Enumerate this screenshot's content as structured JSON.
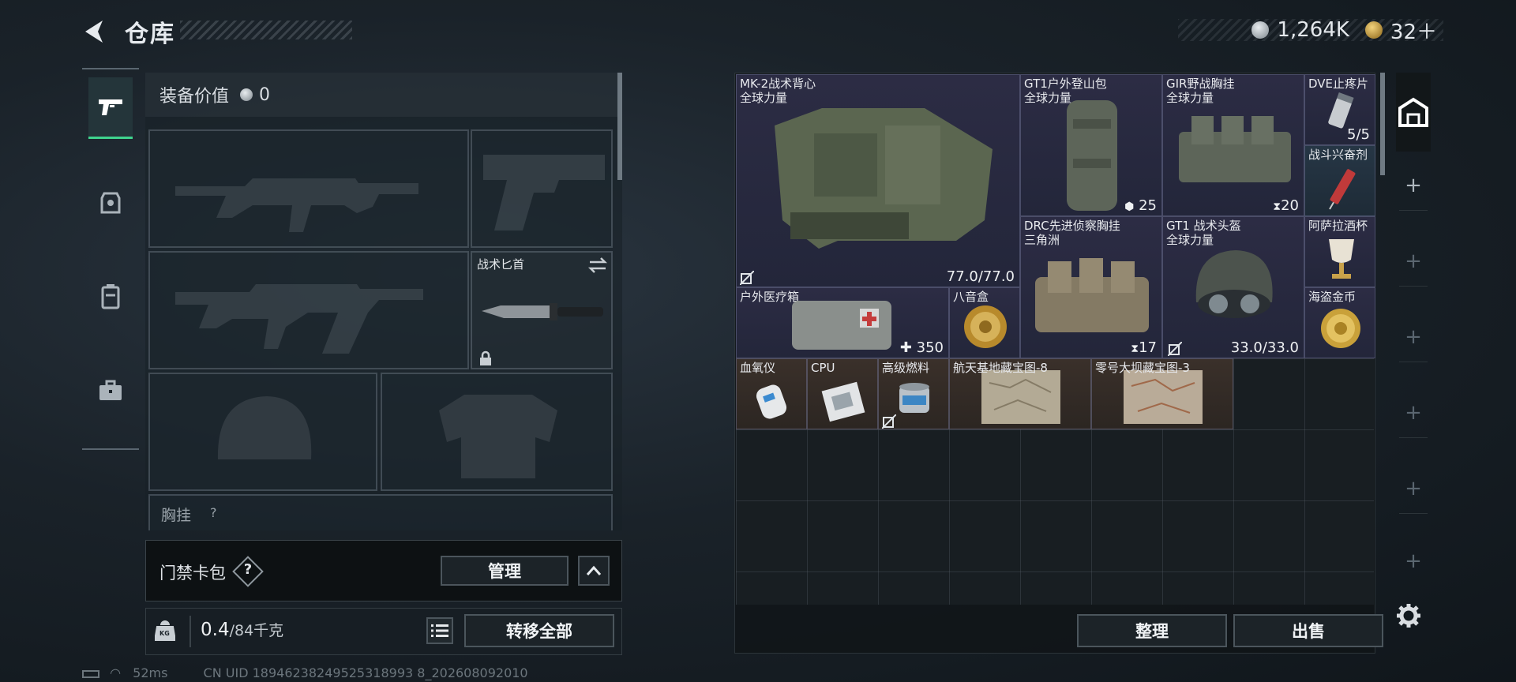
{
  "header": {
    "title": "仓库",
    "silver_amount": "1,264K",
    "gold_amount": "32＋"
  },
  "sidebar": {
    "items": [
      "weapons",
      "helmet",
      "backpack",
      "briefcase"
    ]
  },
  "equipment": {
    "value_label": "装备价值",
    "value": "0",
    "knife_label": "战术匕首",
    "next_slot_label": "胸挂",
    "next_slot_icon_label": "?"
  },
  "keybag": {
    "label": "门禁卡包",
    "help_glyph": "?",
    "manage_label": "管理"
  },
  "weight": {
    "current": "0.4",
    "capacity": "/84千克",
    "transfer_all_label": "转移全部",
    "kg_tag": "KG"
  },
  "inventory": {
    "items": [
      {
        "name": "MK-2战术背心",
        "sub": "全球力量",
        "stat": "77.0/77.0",
        "rarity": "purple"
      },
      {
        "name": "GT1户外登山包",
        "sub": "全球力量",
        "stat": "25",
        "rarity": "purple"
      },
      {
        "name": "GIR野战胸挂",
        "sub": "全球力量",
        "stat": "20",
        "rarity": "purple"
      },
      {
        "name": "DVE止疼片",
        "sub": "",
        "stat": "5/5",
        "rarity": "purple"
      },
      {
        "name": "战斗兴奋剂",
        "sub": "",
        "stat": "",
        "rarity": "blue"
      },
      {
        "name": "DRC先进侦察胸挂",
        "sub": "三角洲",
        "stat": "17",
        "rarity": "purple"
      },
      {
        "name": "GT1 战术头盔",
        "sub": "全球力量",
        "stat": "33.0/33.0",
        "rarity": "purple"
      },
      {
        "name": "阿萨拉酒杯",
        "sub": "",
        "stat": "",
        "rarity": "purple"
      },
      {
        "name": "户外医疗箱",
        "sub": "",
        "stat": "350",
        "rarity": "purple"
      },
      {
        "name": "八音盒",
        "sub": "",
        "stat": "",
        "rarity": "purple"
      },
      {
        "name": "海盗金币",
        "sub": "",
        "stat": "",
        "rarity": "purple"
      },
      {
        "name": "血氧仪",
        "sub": "",
        "stat": "",
        "rarity": "brown"
      },
      {
        "name": "CPU",
        "sub": "",
        "stat": "",
        "rarity": "brown"
      },
      {
        "name": "高级燃料",
        "sub": "",
        "stat": "",
        "rarity": "brown"
      },
      {
        "name": "航天基地藏宝图-8",
        "sub": "",
        "stat": "",
        "rarity": "brown"
      },
      {
        "name": "零号大坝藏宝图-3",
        "sub": "",
        "stat": "",
        "rarity": "brown"
      }
    ],
    "sort_label": "整理",
    "sell_label": "出售"
  },
  "status_bar": {
    "ping": "52ms",
    "uid": "CN UID 18946238249525318993 8_202608092010"
  },
  "colors": {
    "accent_green": "#3fd48e",
    "rarity_purple": "#2c2c44",
    "rarity_brown": "#3a302a",
    "rarity_blue": "#263645"
  }
}
